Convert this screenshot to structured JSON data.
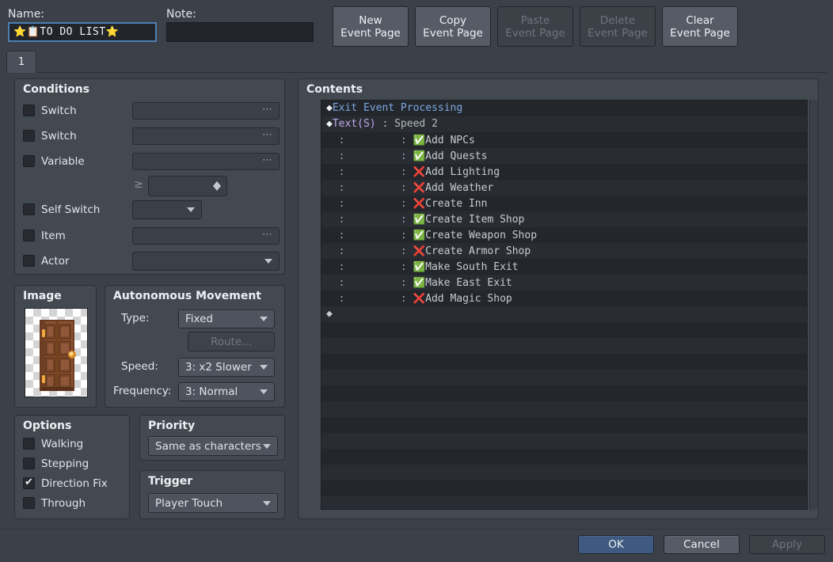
{
  "window": {
    "bg": "#3b4049",
    "panel_bg": "#434951"
  },
  "header": {
    "name_label": "Name:",
    "name_value": "⭐📋TO DO LIST⭐",
    "note_label": "Note:",
    "note_value": "",
    "note_placeholder": ""
  },
  "toolbar": {
    "buttons": [
      {
        "line1": "New",
        "line2": "Event Page",
        "enabled": true,
        "name": "new-event-page-button"
      },
      {
        "line1": "Copy",
        "line2": "Event Page",
        "enabled": true,
        "name": "copy-event-page-button"
      },
      {
        "line1": "Paste",
        "line2": "Event Page",
        "enabled": false,
        "name": "paste-event-page-button"
      },
      {
        "line1": "Delete",
        "line2": "Event Page",
        "enabled": false,
        "name": "delete-event-page-button"
      },
      {
        "line1": "Clear",
        "line2": "Event Page",
        "enabled": true,
        "name": "clear-event-page-button"
      }
    ]
  },
  "tabs": [
    {
      "label": "1",
      "selected": true
    }
  ],
  "conditions": {
    "title": "Conditions",
    "rows": [
      {
        "label": "Switch",
        "checked": false,
        "widget": "dots",
        "value": ""
      },
      {
        "label": "Switch",
        "checked": false,
        "widget": "dots",
        "value": ""
      },
      {
        "label": "Variable",
        "checked": false,
        "widget": "dots",
        "value": ""
      },
      {
        "label": "Self Switch",
        "checked": false,
        "widget": "combo",
        "value": ""
      },
      {
        "label": "Item",
        "checked": false,
        "widget": "dots",
        "value": ""
      },
      {
        "label": "Actor",
        "checked": false,
        "widget": "combo",
        "value": ""
      }
    ],
    "comparison_sign": "≥",
    "comparison_value": ""
  },
  "image": {
    "title": "Image",
    "sprite": "door-sprite",
    "alt": "brown wooden door"
  },
  "autonomous_movement": {
    "title": "Autonomous Movement",
    "type_label": "Type:",
    "type_value": "Fixed",
    "route_label": "Route...",
    "route_enabled": false,
    "speed_label": "Speed:",
    "speed_value": "3: x2 Slower",
    "frequency_label": "Frequency:",
    "frequency_value": "3: Normal"
  },
  "options": {
    "title": "Options",
    "items": [
      {
        "label": "Walking",
        "checked": false
      },
      {
        "label": "Stepping",
        "checked": false
      },
      {
        "label": "Direction Fix",
        "checked": true
      },
      {
        "label": "Through",
        "checked": false
      }
    ]
  },
  "priority": {
    "title": "Priority",
    "value": "Same as characters"
  },
  "trigger": {
    "title": "Trigger",
    "value": "Player Touch"
  },
  "contents": {
    "title": "Contents",
    "rows": [
      {
        "diamond": "white",
        "indent": 0,
        "segments": [
          {
            "text": "Exit Event Processing",
            "color": "blue"
          }
        ]
      },
      {
        "diamond": "white",
        "indent": 0,
        "segments": [
          {
            "text": "Text(S)",
            "color": "purple"
          },
          {
            "text": " : ",
            "color": "gray"
          },
          {
            "text": "Speed 2",
            "color": "gray"
          }
        ]
      },
      {
        "diamond": "none",
        "indent": 2,
        "icon": "check",
        "text": "Add NPCs"
      },
      {
        "diamond": "none",
        "indent": 2,
        "icon": "check",
        "text": "Add Quests"
      },
      {
        "diamond": "none",
        "indent": 2,
        "icon": "cross",
        "text": "Add Lighting"
      },
      {
        "diamond": "none",
        "indent": 2,
        "icon": "cross",
        "text": "Add Weather"
      },
      {
        "diamond": "none",
        "indent": 2,
        "icon": "cross",
        "text": "Create Inn"
      },
      {
        "diamond": "none",
        "indent": 2,
        "icon": "check",
        "text": "Create Item Shop"
      },
      {
        "diamond": "none",
        "indent": 2,
        "icon": "check",
        "text": "Create Weapon Shop"
      },
      {
        "diamond": "none",
        "indent": 2,
        "icon": "cross",
        "text": "Create Armor Shop"
      },
      {
        "diamond": "none",
        "indent": 2,
        "icon": "check",
        "text": "Make South Exit"
      },
      {
        "diamond": "none",
        "indent": 2,
        "icon": "check",
        "text": "Make East Exit"
      },
      {
        "diamond": "none",
        "indent": 2,
        "icon": "cross",
        "text": "Add Magic Shop"
      },
      {
        "diamond": "gray",
        "indent": 0,
        "segments": []
      }
    ],
    "icons": {
      "check": "✅",
      "cross": "❌"
    },
    "indent_marker": ":"
  },
  "footer": {
    "ok_label": "OK",
    "cancel_label": "Cancel",
    "apply_label": "Apply",
    "apply_enabled": false
  }
}
